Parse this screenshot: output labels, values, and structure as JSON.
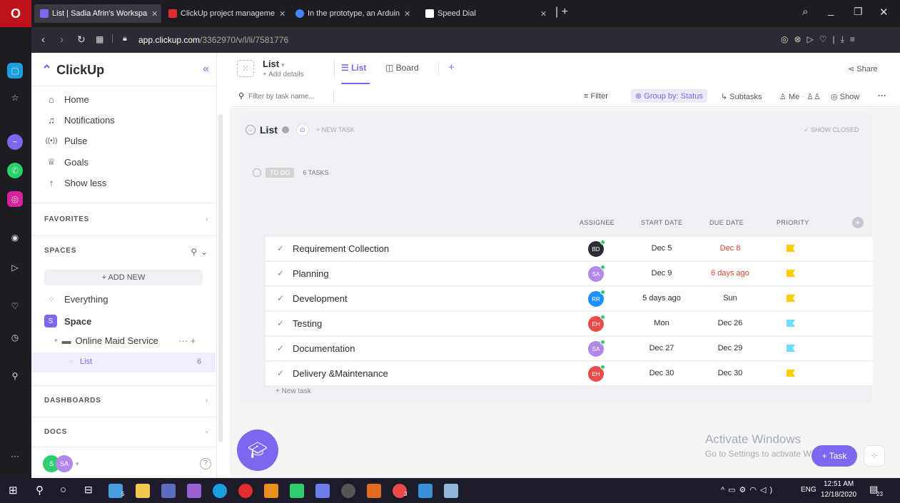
{
  "browser": {
    "tabs": [
      {
        "title": "List | Sadia Afrin's Workspa",
        "color": "#7b68ee",
        "active": true
      },
      {
        "title": "ClickUp project manageme",
        "color": "#e02e2e",
        "active": false
      },
      {
        "title": "In the prototype, an Arduin",
        "color": "#4285f4",
        "active": false
      },
      {
        "title": "Speed Dial",
        "color": "#ffffff",
        "active": false
      }
    ],
    "url_domain": "app.clickup.com",
    "url_path": "/3362970/v/l/li/7581776"
  },
  "sidebar": {
    "brand": "ClickUp",
    "nav": [
      {
        "label": "Home",
        "icon": "home-icon"
      },
      {
        "label": "Notifications",
        "icon": "bell-icon"
      },
      {
        "label": "Pulse",
        "icon": "pulse-icon"
      },
      {
        "label": "Goals",
        "icon": "trophy-icon"
      },
      {
        "label": "Show less",
        "icon": "arrow-up-icon"
      }
    ],
    "favorites_label": "FAVORITES",
    "spaces_label": "SPACES",
    "add_new_label": "+ ADD NEW",
    "everything_label": "Everything",
    "space_label": "Space",
    "space_initial": "S",
    "folder_label": "Online Maid Service",
    "list_label": "List",
    "list_count": "6",
    "dashboards_label": "DASHBOARDS",
    "docs_label": "DOCS",
    "user_initials_1": "S",
    "user_initials_2": "SA",
    "help_icon": "?"
  },
  "header": {
    "list_title": "List",
    "add_details": "+ Add details",
    "tab_list": "List",
    "tab_board": "Board",
    "add_view": "+",
    "share": "Share"
  },
  "toolbar": {
    "search_placeholder": "Filter by task name...",
    "filter": "Filter",
    "group_by": "Group by: Status",
    "subtasks": "Subtasks",
    "me": "Me",
    "show": "Show",
    "more": "···"
  },
  "list": {
    "title": "List",
    "new_task": "+ NEW TASK",
    "show_closed": "✓ SHOW CLOSED",
    "status_label": "TO DO",
    "task_count": "6 TASKS",
    "columns": {
      "assignee": "ASSIGNEE",
      "start": "START DATE",
      "due": "DUE DATE",
      "priority": "PRIORITY"
    },
    "tasks": [
      {
        "name": "Requirement Collection",
        "assignee": "BD",
        "avatar_color": "#292d34",
        "start": "Dec 5",
        "due": "Dec 8",
        "due_color": "#e44332",
        "priority_color": "#ffcc00"
      },
      {
        "name": "Planning",
        "assignee": "SA",
        "avatar_color": "#b388eb",
        "start": "Dec 9",
        "due": "6 days ago",
        "due_color": "#e44332",
        "priority_color": "#ffcc00"
      },
      {
        "name": "Development",
        "assignee": "RR",
        "avatar_color": "#1e90ff",
        "start": "5 days ago",
        "due": "Sun",
        "due_color": "#292d34",
        "priority_color": "#ffcc00"
      },
      {
        "name": "Testing",
        "assignee": "EH",
        "avatar_color": "#e94b4b",
        "start": "Mon",
        "due": "Dec 26",
        "due_color": "#292d34",
        "priority_color": "#6fddff"
      },
      {
        "name": "Documentation",
        "assignee": "SA",
        "avatar_color": "#b388eb",
        "start": "Dec 27",
        "due": "Dec 29",
        "due_color": "#292d34",
        "priority_color": "#6fddff"
      },
      {
        "name": "Delivery &Maintenance",
        "assignee": "EH",
        "avatar_color": "#e94b4b",
        "start": "Dec 30",
        "due": "Dec 30",
        "due_color": "#292d34",
        "priority_color": "#ffcc00"
      }
    ],
    "new_task_row": "+ New task"
  },
  "watermark": {
    "line1": "Activate Windows",
    "line2": "Go to Settings to activate Windows."
  },
  "fab": {
    "task_label": "+ Task"
  },
  "taskbar": {
    "time": "12:51 AM",
    "date": "12/18/2020",
    "lang": "ENG",
    "notif_count": "23",
    "badge_5": "5",
    "badge_3": "3"
  },
  "colors": {
    "brand": "#7b68ee",
    "accent": "#7b68ee"
  }
}
